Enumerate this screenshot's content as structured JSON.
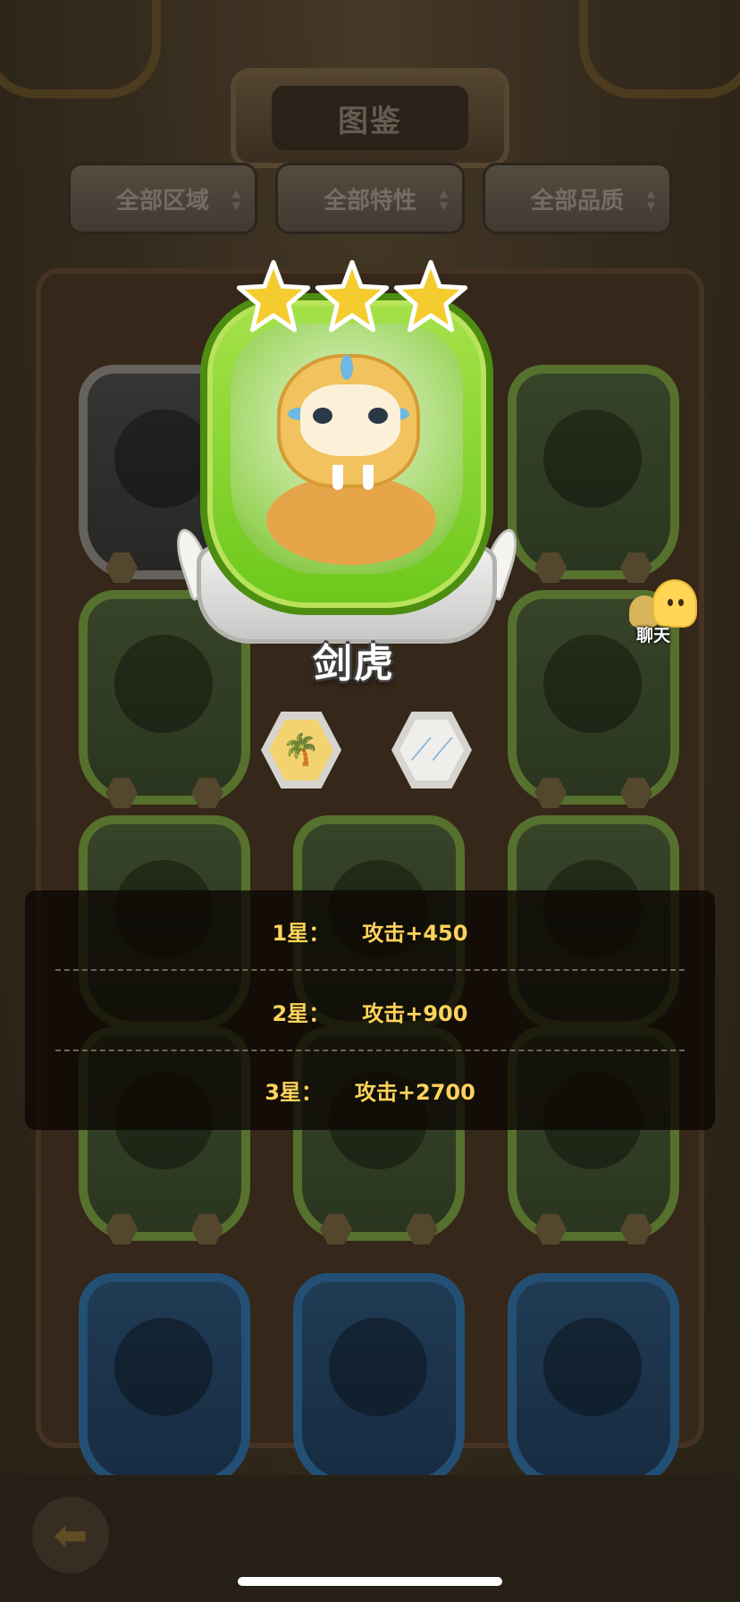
{
  "header": {
    "title": "图鉴"
  },
  "filters": [
    {
      "label": "全部区域"
    },
    {
      "label": "全部特性"
    },
    {
      "label": "全部品质"
    }
  ],
  "featured": {
    "name": "剑虎",
    "stars": 3,
    "traits": [
      {
        "icon": "palm-island-icon"
      },
      {
        "icon": "claw-icon"
      }
    ]
  },
  "chat": {
    "label": "聊天"
  },
  "bonuses": [
    {
      "level": "1星：",
      "value": "攻击+450"
    },
    {
      "level": "2星：",
      "value": "攻击+900"
    },
    {
      "level": "3星：",
      "value": "攻击+2700"
    }
  ],
  "colors": {
    "bonus_text": "#ffd35c",
    "frame_green": "#6cc81b",
    "star_gold": "#f5cc2f"
  }
}
